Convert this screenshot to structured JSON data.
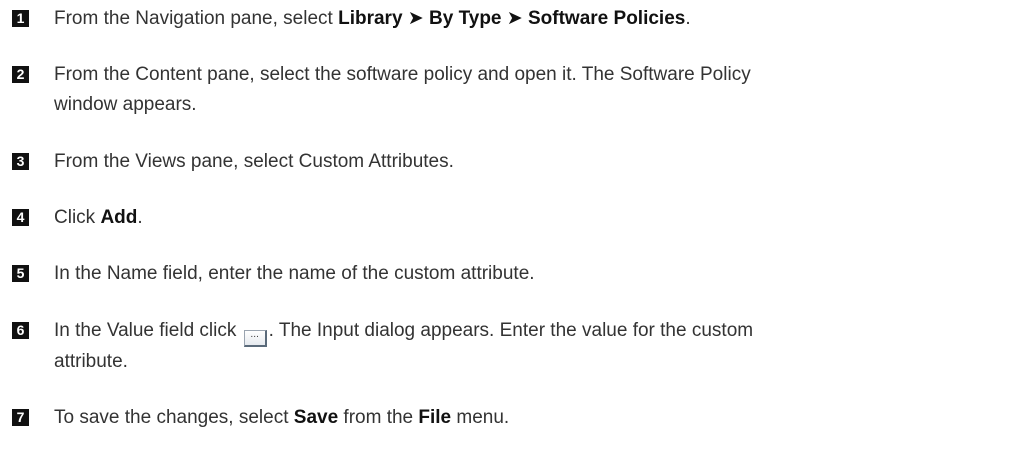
{
  "steps": [
    {
      "number": "1",
      "pre": "From the Navigation pane, select ",
      "path_1": "Library",
      "sep_1": " ➤ ",
      "path_2": "By Type",
      "sep_2": " ➤ ",
      "path_3": "Software Policies",
      "post": "."
    },
    {
      "number": "2",
      "text_line_1": "From the Content pane, select the software policy and open it. The Software Policy",
      "text_line_2": "window appears."
    },
    {
      "number": "3",
      "text": "From the Views pane, select Custom Attributes."
    },
    {
      "number": "4",
      "pre": "Click ",
      "bold": "Add",
      "post": "."
    },
    {
      "number": "5",
      "text": "In the Name field, enter the name of the custom attribute."
    },
    {
      "number": "6",
      "pre": "In the Value field click ",
      "button_glyph": "...",
      "post": ". The Input dialog appears. Enter the value for the custom",
      "text_line_2": "attribute."
    },
    {
      "number": "7",
      "pre": "To save the changes, select ",
      "bold_1": "Save",
      "mid": " from the ",
      "bold_2": "File",
      "post": " menu."
    }
  ]
}
